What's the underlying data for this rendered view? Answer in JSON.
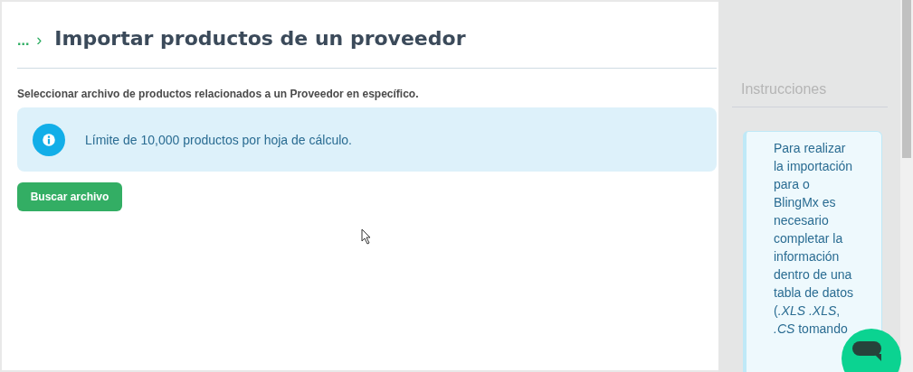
{
  "breadcrumb": {
    "ellipsis": "...",
    "separator": "›"
  },
  "title": "Importar productos de un proveedor",
  "subtitle": "Seleccionar archivo de productos relacionados a un Proveedor en específico.",
  "info_alert": {
    "text": "Límite de 10,000 productos por hoja de cálculo."
  },
  "buttons": [
    {
      "label": "Buscar archivo"
    }
  ],
  "sidebar": {
    "heading": "Instrucciones",
    "text": "Para realizar la importación para o BlingMx es necesario completar la información dentro de una tabla de datos (*.XLS* *.XLS*, *.CS* tomando"
  }
}
